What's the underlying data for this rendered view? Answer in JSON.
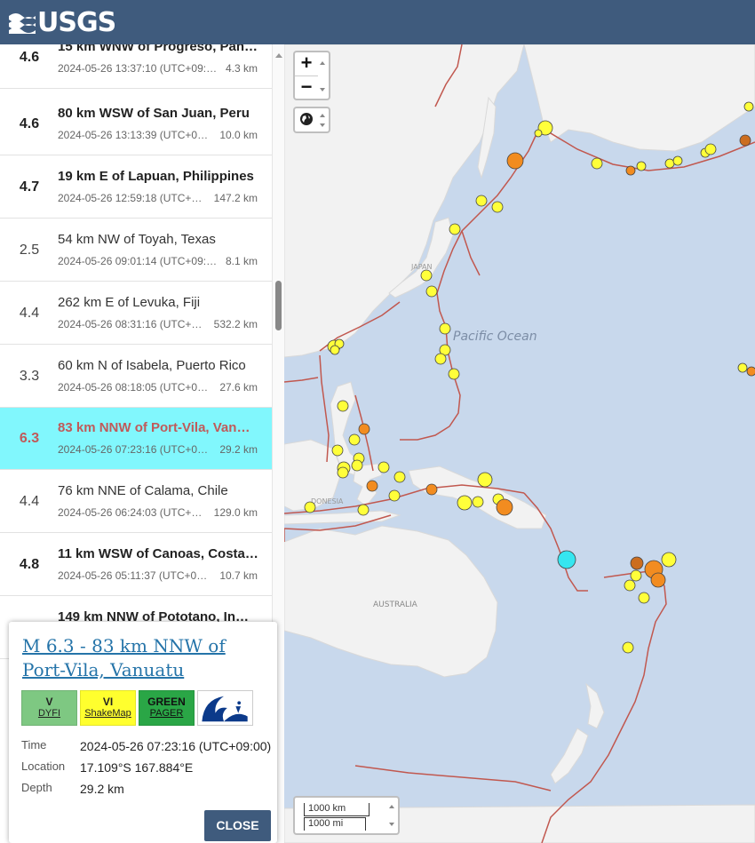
{
  "header": {
    "logo_text": "USGS",
    "logo_icon": "usgs-wave-icon",
    "color": "#3f5b7d"
  },
  "earthquakes": [
    {
      "mag": "4.6",
      "place": "15 km WNW of Progreso, Pan…",
      "time": "2024-05-26 13:37:10 (UTC+09:…",
      "depth": "4.3 km",
      "bold": true
    },
    {
      "mag": "4.6",
      "place": "80 km WSW of San Juan, Peru",
      "time": "2024-05-26 13:13:39 (UTC+0…",
      "depth": "10.0 km",
      "bold": true
    },
    {
      "mag": "4.7",
      "place": "19 km E of Lapuan, Philippines",
      "time": "2024-05-26 12:59:18 (UTC+…",
      "depth": "147.2 km",
      "bold": true
    },
    {
      "mag": "2.5",
      "place": "54 km NW of Toyah, Texas",
      "time": "2024-05-26 09:01:14 (UTC+09:…",
      "depth": "8.1 km",
      "bold": false
    },
    {
      "mag": "4.4",
      "place": "262 km E of Levuka, Fiji",
      "time": "2024-05-26 08:31:16 (UTC+…",
      "depth": "532.2 km",
      "bold": false
    },
    {
      "mag": "3.3",
      "place": "60 km N of Isabela, Puerto Rico",
      "time": "2024-05-26 08:18:05 (UTC+0…",
      "depth": "27.6 km",
      "bold": false
    },
    {
      "mag": "6.3",
      "place": "83 km NNW of Port-Vila, Van…",
      "time": "2024-05-26 07:23:16 (UTC+0…",
      "depth": "29.2 km",
      "bold": true,
      "selected": true
    },
    {
      "mag": "4.4",
      "place": "76 km NNE of Calama, Chile",
      "time": "2024-05-26 06:24:03 (UTC+…",
      "depth": "129.0 km",
      "bold": false
    },
    {
      "mag": "4.8",
      "place": "11 km WSW of Canoas, Costa…",
      "time": "2024-05-26 05:11:37 (UTC+0…",
      "depth": "10.7 km",
      "bold": true
    },
    {
      "mag": "",
      "place": "149 km NNW of Pototano, In…",
      "time": "",
      "depth": "",
      "bold": true
    }
  ],
  "selected_colors": {
    "row_bg": "#81f7fd",
    "text": "#c05a5a"
  },
  "map": {
    "ocean_label": "Pacific Ocean",
    "labels": {
      "japan": "JAPAN",
      "indonesia": "DONESIA",
      "australia": "AUSTRALIA"
    },
    "controls": {
      "zoom_in": "+",
      "zoom_out": "−",
      "layers_icon": "globe-icon"
    },
    "scale": {
      "km": "1000 km",
      "mi": "1000 mi"
    },
    "colors": {
      "ocean": "#c8d8ec",
      "land": "#f2f2f2",
      "plate_boundary": "#c1584f",
      "yellow": "#ffff3a",
      "orange": "#f28c20",
      "dark_orange": "#cc6d1f",
      "cyan": "#35e6f0"
    }
  },
  "popup": {
    "title": "M 6.3 - 83 km NNW of Port-Vila, Vanuatu",
    "dyfi": {
      "value": "V",
      "label": "DYFI"
    },
    "shakemap": {
      "value": "VI",
      "label": "ShakeMap"
    },
    "pager": {
      "value": "GREEN",
      "label": "PAGER"
    },
    "tsunami_icon": "tsunami-icon",
    "time_label": "Time",
    "time": "2024-05-26 07:23:16 (UTC+09:00)",
    "location_label": "Location",
    "location": "17.109°S 167.884°E",
    "depth_label": "Depth",
    "depth": "29.2 km",
    "close_label": "CLOSE"
  }
}
